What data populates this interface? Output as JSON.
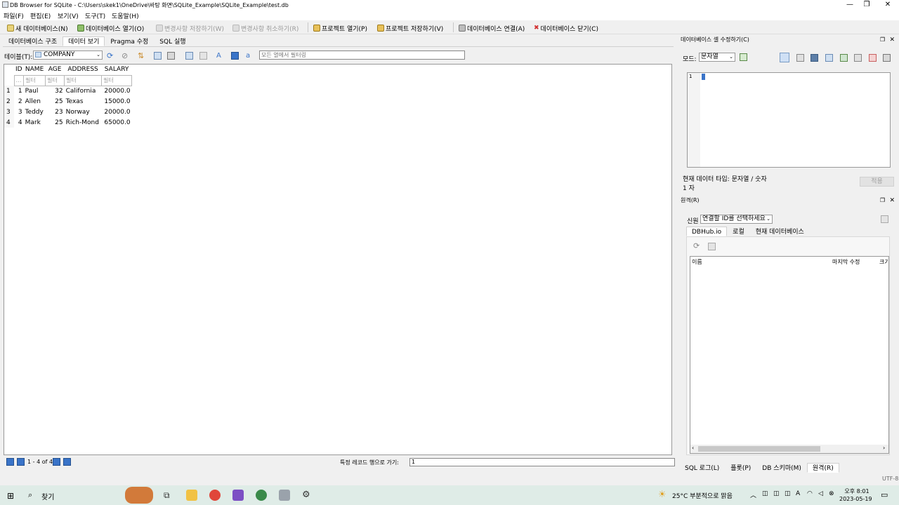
{
  "window": {
    "title": "DB Browser for SQLite - C:\\Users\\skek1\\OneDrive\\바탕 화면\\SQLite_Example\\SQLite_Example\\test.db",
    "min": "—",
    "restore": "❐",
    "close": "✕"
  },
  "menu": [
    "파일(F)",
    "편집(E)",
    "보기(V)",
    "도구(T)",
    "도움말(H)"
  ],
  "toolbar": {
    "new_db": "새 데이터베이스(N)",
    "open_db": "데이터베이스 열기(O)",
    "write_changes": "변경사항 저장하기(W)",
    "revert_changes": "변경사항 취소하기(R)",
    "open_project": "프로젝트 열기(P)",
    "save_project": "프로젝트 저장하기(V)",
    "attach_db": "데이터베이스 연결(A)",
    "close_db": "데이터베이스 닫기(C)"
  },
  "main_tabs": [
    "데이터베이스 구조",
    "데이터 보기",
    "Pragma 수정",
    "SQL 실행"
  ],
  "browse": {
    "table_label": "테이블(T):",
    "table_value": "COMPANY",
    "filter_placeholder": "모든 열에서 필터링",
    "columns": [
      "ID",
      "NAME",
      "AGE",
      "ADDRESS",
      "SALARY"
    ],
    "filter_text": "필터",
    "rows": [
      {
        "rn": "1",
        "id": "1",
        "name": "Paul",
        "age": "32",
        "address": "California",
        "salary": "20000.0"
      },
      {
        "rn": "2",
        "id": "2",
        "name": "Allen",
        "age": "25",
        "address": "Texas",
        "salary": "15000.0"
      },
      {
        "rn": "3",
        "id": "3",
        "name": "Teddy",
        "age": "23",
        "address": "Norway",
        "salary": "20000.0"
      },
      {
        "rn": "4",
        "id": "4",
        "name": "Mark",
        "age": "25",
        "address": "Rich-Mond",
        "salary": "65000.0"
      }
    ],
    "pagination": "1 - 4 of 4",
    "goto_label": "특정 레코드 행으로 가기:",
    "goto_value": "1"
  },
  "edit_cell": {
    "header": "데이터베이스 셀 수정하기(C)",
    "mode_label": "모드:",
    "mode_value": "문자열",
    "line_no": "1",
    "type_info": "현재 데이터 타입: 문자열 / 숫자",
    "size_info": "1 자",
    "apply": "적용"
  },
  "remote": {
    "header": "원격(R)",
    "identity_label": "신원",
    "identity_value": "연결할 ID를 선택하세요",
    "tabs": [
      "DBHub.io",
      "로컬",
      "현재 데이터베이스"
    ],
    "columns": [
      "이름",
      "마지막 수정",
      "크기"
    ]
  },
  "bottom_tabs": [
    "SQL 로그(L)",
    "플롯(P)",
    "DB 스키마(M)",
    "원격(R)"
  ],
  "encoding": "UTF-8",
  "taskbar": {
    "search": "찾기",
    "weather": "25°C  부분적으로 맑음",
    "time": "오후 8:01",
    "date": "2023-05-19"
  },
  "colors": {
    "accent": "#3a74c8",
    "close_red": "#d23030",
    "taskbar": "#dfece7"
  }
}
